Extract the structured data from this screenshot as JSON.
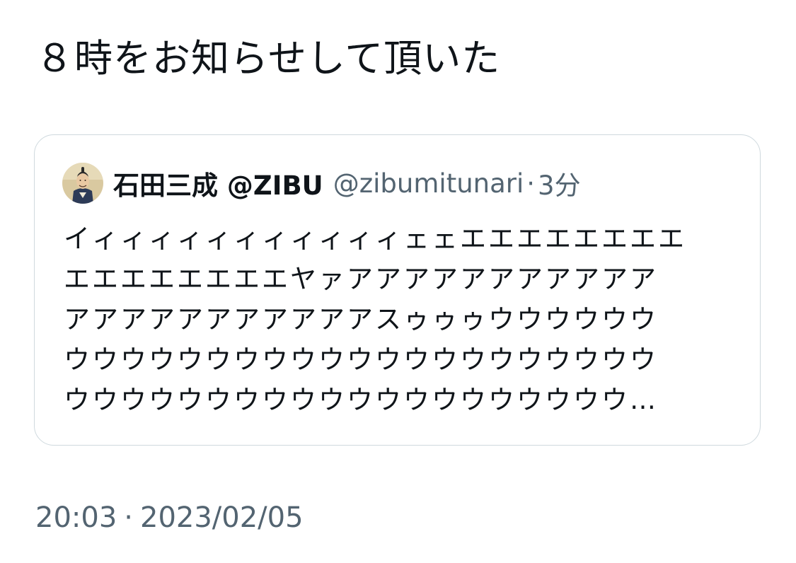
{
  "tweet": {
    "text": "８時をお知らせして頂いた",
    "time": "20:03",
    "separator": "·",
    "date": "2023/02/05"
  },
  "quote": {
    "author_name": "石田三成 @ZIBU",
    "author_handle": "@zibumitunari",
    "separator": "·",
    "relative_time": "3分",
    "avatar_icon": "samurai-portrait-avatar",
    "body_lines": [
      "イィィィィィィィィィィィェェエエエエエエエエ",
      "エエエエエエエエヤァアアアアアアアアアアア",
      "アアアアアアアアアアアスゥゥゥウウウウウウ",
      "ウウウウウウウウウウウウウウウウウウウウウ",
      "ウウウウウウウウウウウウウウウウウウウウ…"
    ]
  },
  "colors": {
    "text_primary": "#0f1419",
    "text_secondary": "#536471",
    "border": "#cfd9de",
    "background": "#ffffff"
  }
}
